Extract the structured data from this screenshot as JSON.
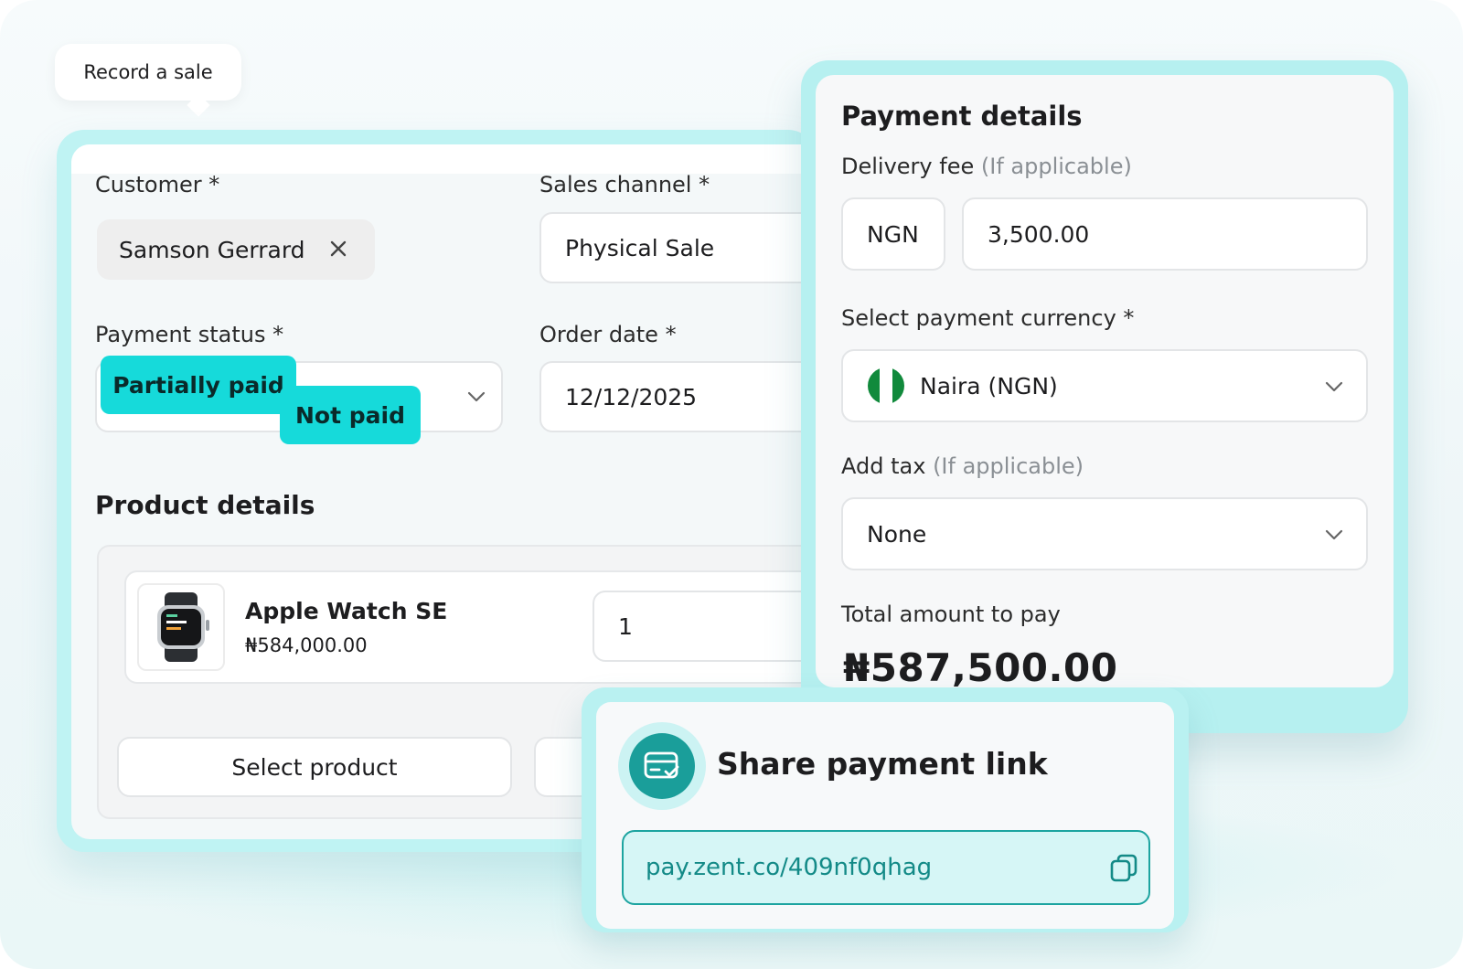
{
  "tooltip": {
    "label": "Record a sale"
  },
  "sale_form": {
    "customer": {
      "label": "Customer *",
      "value": "Samson Gerrard"
    },
    "sales_channel": {
      "label": "Sales channel *",
      "value": "Physical Sale"
    },
    "payment_status": {
      "label": "Payment status *",
      "options": [
        "Partially paid",
        "Not paid"
      ]
    },
    "order_date": {
      "label": "Order date *",
      "value": "12/12/2025"
    },
    "product_details": {
      "title": "Product details",
      "items": [
        {
          "name": "Apple Watch SE",
          "price": "₦584,000.00",
          "quantity": "1"
        }
      ],
      "select_button": "Select product"
    }
  },
  "payment": {
    "title": "Payment details",
    "delivery_fee": {
      "label": "Delivery fee",
      "hint": "(If applicable)",
      "currency": "NGN",
      "value": "3,500.00"
    },
    "currency": {
      "label": "Select payment currency *",
      "value": "Naira (NGN)",
      "flag_colors": [
        "#118a3c",
        "#ffffff",
        "#118a3c"
      ]
    },
    "tax": {
      "label": "Add tax",
      "hint": "(If applicable)",
      "value": "None"
    },
    "total": {
      "label": "Total amount to pay",
      "value": "₦587,500.00"
    }
  },
  "share": {
    "title": "Share payment link",
    "link": "pay.zent.co/409nf0qhag",
    "icon": "card-check-icon",
    "copy_icon": "copy-icon"
  },
  "colors": {
    "accent": "#16dada",
    "teal": "#1a9e9a",
    "frame": "#b6f0f0"
  }
}
